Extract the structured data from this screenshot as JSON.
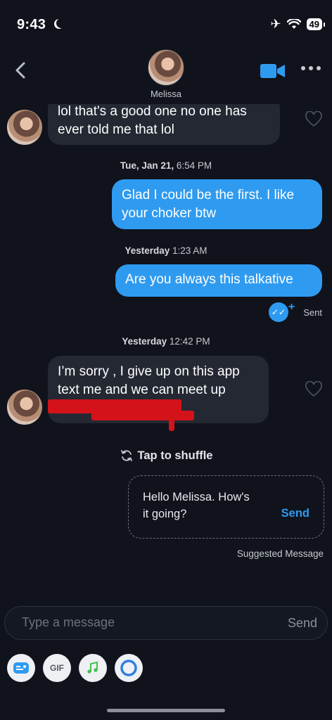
{
  "status_bar": {
    "time": "9:43",
    "battery": "49"
  },
  "header": {
    "contact_name": "Melissa"
  },
  "messages": {
    "m1": {
      "line1": "lol that's a good one no one has",
      "line2": "ever told me that lol"
    },
    "ts1": {
      "day": "Tue, Jan 21,",
      "time": "6:54 PM"
    },
    "m2": {
      "line1": "Glad I could be the first. I like",
      "line2": "your choker btw"
    },
    "ts2": {
      "day": "Yesterday",
      "time": "1:23 AM"
    },
    "m3": {
      "text": "Are you always this talkative"
    },
    "sent_label": "Sent",
    "ts3": {
      "day": "Yesterday",
      "time": "12:42 PM"
    },
    "m4": {
      "line1": "I’m sorry , I give up on this app",
      "line2": "text me and we can meet up"
    }
  },
  "shuffle": {
    "label": "Tap to shuffle"
  },
  "suggestion": {
    "line1": "Hello Melissa. How's",
    "line2": "it going?",
    "send_label": "Send",
    "caption": "Suggested Message"
  },
  "composer": {
    "placeholder": "Type a message",
    "send_label": "Send"
  },
  "toolbar": {
    "gif_label": "GIF"
  },
  "colors": {
    "accent": "#2f9bf0",
    "background": "#10131c",
    "incoming_bubble": "#242833",
    "redaction": "#d4121a"
  },
  "icons": [
    "back-chevron-icon",
    "video-call-icon",
    "more-dots-icon",
    "heart-icon",
    "double-check-icon",
    "shuffle-icon",
    "sticker-icon",
    "music-icon",
    "circle-icon",
    "airplane-icon",
    "wifi-icon",
    "moon-icon"
  ]
}
